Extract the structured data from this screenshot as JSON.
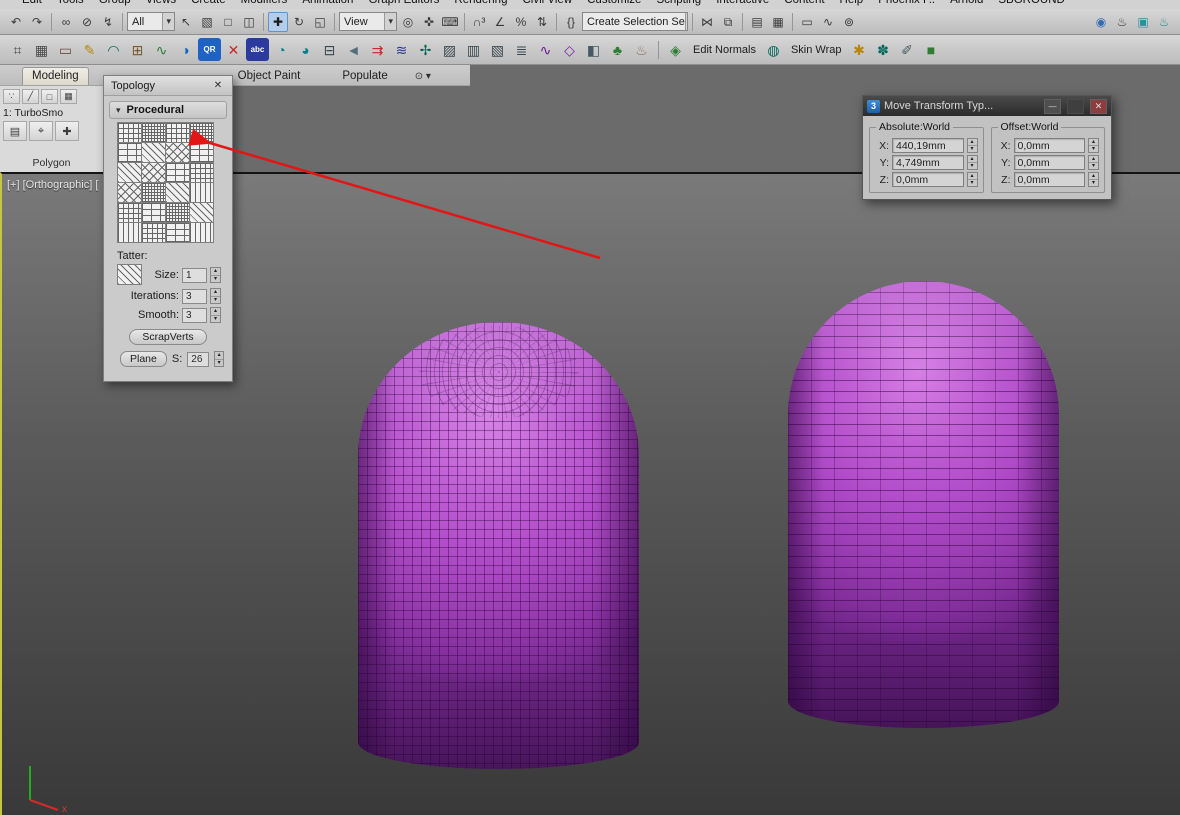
{
  "colors": {
    "object_purple": "#b44ecb",
    "annotation_red": "#e31515",
    "viewport_border_yellow": "#c9c43f",
    "move_tool_highlight_blue": "#b3cdea"
  },
  "menubar": {
    "items": [
      "Edit",
      "Tools",
      "Group",
      "Views",
      "Create",
      "Modifiers",
      "Animation",
      "Graph Editors",
      "Rendering",
      "Civil View",
      "Customize",
      "Scripting",
      "Interactive",
      "Content",
      "Help",
      "Phoenix F..",
      "Arnold",
      "SBGROUND"
    ]
  },
  "toolbar1": {
    "g1": [
      {
        "n": "undo-icon",
        "g": "↶"
      },
      {
        "n": "redo-icon",
        "g": "↷"
      }
    ],
    "g2": [
      {
        "n": "select-and-link-icon",
        "g": "∞"
      },
      {
        "n": "unlink-selection-icon",
        "g": "⊘"
      },
      {
        "n": "bind-to-spacewarp-icon",
        "g": "↯"
      }
    ],
    "filter_dropdown": "All",
    "g3": [
      {
        "n": "select-object-icon",
        "g": "↖"
      },
      {
        "n": "select-by-name-icon",
        "g": "▧"
      },
      {
        "n": "rectangular-selection-icon",
        "g": "□"
      },
      {
        "n": "window-crossing-icon",
        "g": "◫"
      }
    ],
    "g4": [
      {
        "n": "select-move-icon",
        "g": "✚",
        "s": "background:#b3cdea;border:1px solid #6592c6;color:#1c1c1c"
      },
      {
        "n": "select-rotate-icon",
        "g": "↻"
      },
      {
        "n": "select-scale-icon",
        "g": "◱"
      }
    ],
    "coord_dropdown": "View",
    "g5": [
      {
        "n": "use-pivot-center-icon",
        "g": "◎"
      },
      {
        "n": "select-manipulate-icon",
        "g": "✜"
      },
      {
        "n": "keyboard-override-icon",
        "g": "⌨"
      }
    ],
    "g6": [
      {
        "n": "snap-toggle-icon",
        "g": "∩³"
      },
      {
        "n": "angle-snap-icon",
        "g": "∠"
      },
      {
        "n": "percent-snap-icon",
        "g": "%"
      },
      {
        "n": "spinner-snap-icon",
        "g": "⇅"
      }
    ],
    "g7": [
      {
        "n": "named-selection-sets-icon",
        "g": "{}"
      }
    ],
    "selection_set_dropdown": "Create Selection Se",
    "g8": [
      {
        "n": "mirror-icon",
        "g": "⋈"
      },
      {
        "n": "align-icon",
        "g": "⧉"
      }
    ],
    "g9": [
      {
        "n": "scene-explorer-icon",
        "g": "▤"
      },
      {
        "n": "layer-explorer-icon",
        "g": "▦"
      }
    ],
    "g10": [
      {
        "n": "ribbon-toggle-icon",
        "g": "▭"
      },
      {
        "n": "curve-editor-icon",
        "g": "∿"
      },
      {
        "n": "schematic-view-icon",
        "g": "⊚"
      }
    ],
    "g11": [
      {
        "n": "material-editor-icon",
        "g": "◉",
        "s": "color:#2f6db5"
      },
      {
        "n": "render-setup-icon",
        "g": "♨"
      },
      {
        "n": "rendered-frame-icon",
        "g": "▣",
        "s": "color:#2f8fa0"
      },
      {
        "n": "render-production-icon",
        "g": "♨",
        "s": "color:#1d8f93"
      }
    ]
  },
  "toolbar2": {
    "icons_a": [
      {
        "n": "grid-snap-icon",
        "g": "⌗",
        "s": "color:#4a4a4a"
      },
      {
        "n": "dot-grid-icon",
        "g": "▦",
        "s": "color:#4a4a4a"
      },
      {
        "n": "ruler-icon",
        "g": "▭",
        "s": "color:#6d4c41"
      },
      {
        "n": "pencil-tool-icon",
        "g": "✎",
        "s": "color:#b8860b"
      },
      {
        "n": "arc-modifier-icon",
        "g": "◠",
        "s": "color:#00695c"
      },
      {
        "n": "ffd-box-icon",
        "g": "⊞",
        "s": "color:#7a5a2a"
      },
      {
        "n": "wave-modifier-icon",
        "g": "∿",
        "s": "color:#2e7d32"
      },
      {
        "n": "boolean-tool-icon",
        "g": "◑",
        "s": "color:#1565c0"
      },
      {
        "n": "qr-tool-icon",
        "g": "QR",
        "s": "background:#1e63c4;color:#fff;font-size:8px;font-weight:700;border-radius:3px"
      },
      {
        "n": "cross-section-icon",
        "g": "✕",
        "s": "color:#c62828"
      },
      {
        "n": "abc-text-icon",
        "g": "abc",
        "s": "background:#2b3a9e;color:#fff;font-size:8px;font-weight:700;border-radius:3px"
      },
      {
        "n": "arc-tool-icon",
        "g": "◔",
        "s": "color:#00838f"
      },
      {
        "n": "pie-tool-icon",
        "g": "◕",
        "s": "color:#00838f"
      },
      {
        "n": "panel-tool-icon",
        "g": "⊟",
        "s": "color:#37474f"
      },
      {
        "n": "prev-arrow-icon",
        "g": "◄",
        "s": "color:#546e7a"
      },
      {
        "n": "transfer-icon",
        "g": "⇉",
        "s": "color:#c62828"
      },
      {
        "n": "noise-modifier-icon",
        "g": "≋",
        "s": "color:#283593"
      },
      {
        "n": "cross-tool-icon",
        "g": "✢",
        "s": "color:#00695c"
      },
      {
        "n": "hatch-pattern-icon",
        "g": "▨",
        "s": "color:#37474f"
      },
      {
        "n": "columns-pattern-icon",
        "g": "▥",
        "s": "color:#37474f"
      },
      {
        "n": "diag-pattern-icon",
        "g": "▧",
        "s": "color:#37474f"
      },
      {
        "n": "rows-pattern-icon",
        "g": "≣",
        "s": "color:#37474f"
      },
      {
        "n": "spline-icon",
        "g": "∿",
        "s": "color:#6a1b9a"
      },
      {
        "n": "diamond-tool-icon",
        "g": "◇",
        "s": "color:#7b1fa2"
      },
      {
        "n": "half-fill-icon",
        "g": "◧",
        "s": "color:#455a64"
      },
      {
        "n": "foliage-icon",
        "g": "♣",
        "s": "color:#2e7d32"
      },
      {
        "n": "teapot-icon",
        "g": "♨",
        "s": "color:#8d6e63"
      }
    ],
    "edit_normals_icon": [
      {
        "n": "edit-normals-icon",
        "g": "◈",
        "s": "color:#2e7d32"
      }
    ],
    "edit_normals_label": "Edit Normals",
    "skin_wrap_icon": [
      {
        "n": "skin-wrap-icon",
        "g": "◍",
        "s": "color:#00695c"
      }
    ],
    "skin_wrap_label": "Skin Wrap",
    "icons_b": [
      {
        "n": "star-burst-icon",
        "g": "✱",
        "s": "color:#b8860b"
      },
      {
        "n": "flower-tool-icon",
        "g": "✽",
        "s": "color:#00695c"
      },
      {
        "n": "pen-tool-icon",
        "g": "✐",
        "s": "color:#455a64"
      },
      {
        "n": "green-cube-icon",
        "g": "■",
        "s": "color:#2e7d32"
      }
    ]
  },
  "ribbon": {
    "tabs": {
      "modeling": "Modeling",
      "object_paint": "Object Paint",
      "populate": "Populate"
    },
    "panel": {
      "subobject_icons": [
        {
          "n": "vertex-mode-icon",
          "g": "∵"
        },
        {
          "n": "edge-mode-icon",
          "g": "╱"
        },
        {
          "n": "border-mode-icon",
          "g": "□"
        },
        {
          "n": "polygon-mode-icon",
          "g": "▦"
        }
      ],
      "modifier_text": "1: TurboSmo",
      "tool_icons": [
        {
          "n": "modifier-stack-icon",
          "g": "▤"
        },
        {
          "n": "pin-stack-icon",
          "g": "⌖"
        },
        {
          "n": "show-end-result-icon",
          "g": "✚"
        }
      ],
      "section_label": "Polygon"
    }
  },
  "viewport": {
    "label": "[+] [Orthographic] [",
    "axis_x_label": "x"
  },
  "topology_panel": {
    "title": "Topology",
    "rollout_label": "Procedural",
    "patterns": [
      {
        "n": "topology-pattern-icon",
        "p": "grid"
      },
      {
        "n": "topology-pattern-icon",
        "p": "dense"
      },
      {
        "n": "topology-pattern-icon",
        "p": "grid"
      },
      {
        "n": "topology-pattern-icon",
        "p": "dense"
      },
      {
        "n": "topology-pattern-icon",
        "p": "brick"
      },
      {
        "n": "topology-pattern-icon",
        "p": "diag"
      },
      {
        "n": "topology-pattern-icon",
        "p": "cross"
      },
      {
        "n": "topology-pattern-icon",
        "p": "brick"
      },
      {
        "n": "topology-pattern-icon",
        "p": "diag"
      },
      {
        "n": "topology-pattern-icon",
        "p": "cross"
      },
      {
        "n": "topology-pattern-icon",
        "p": "brick"
      },
      {
        "n": "topology-pattern-icon",
        "p": "grid"
      },
      {
        "n": "topology-pattern-icon",
        "p": "cross"
      },
      {
        "n": "topology-pattern-icon",
        "p": "dense"
      },
      {
        "n": "topology-pattern-icon",
        "p": "diag"
      },
      {
        "n": "topology-pattern-icon",
        "p": "cols"
      },
      {
        "n": "topology-pattern-icon",
        "p": "grid"
      },
      {
        "n": "topology-pattern-icon",
        "p": "brick"
      },
      {
        "n": "topology-pattern-icon",
        "p": "dense"
      },
      {
        "n": "topology-pattern-icon",
        "p": "diag"
      },
      {
        "n": "topology-pattern-icon",
        "p": "cols"
      },
      {
        "n": "topology-pattern-icon",
        "p": "grid"
      },
      {
        "n": "topology-pattern-icon",
        "p": "brick"
      },
      {
        "n": "topology-pattern-icon",
        "p": "cols"
      }
    ],
    "tatter_label": "Tatter:",
    "size_label": "Size:",
    "size_value": "1",
    "iterations_label": "Iterations:",
    "iterations_value": "3",
    "smooth_label": "Smooth:",
    "smooth_value": "3",
    "scrapverts_button": "ScrapVerts",
    "plane_button": "Plane",
    "s_label": "S:",
    "s_value": "26"
  },
  "transform_dialog": {
    "title": "Move Transform Typ...",
    "absolute_group": "Absolute:World",
    "offset_group": "Offset:World",
    "absolute_rows": [
      {
        "l": "X:",
        "v": "440,19mm"
      },
      {
        "l": "Y:",
        "v": "4,749mm"
      },
      {
        "l": "Z:",
        "v": "0,0mm"
      }
    ],
    "offset_rows": [
      {
        "l": "X:",
        "v": "0,0mm"
      },
      {
        "l": "Y:",
        "v": "0,0mm"
      },
      {
        "l": "Z:",
        "v": "0,0mm"
      }
    ]
  }
}
